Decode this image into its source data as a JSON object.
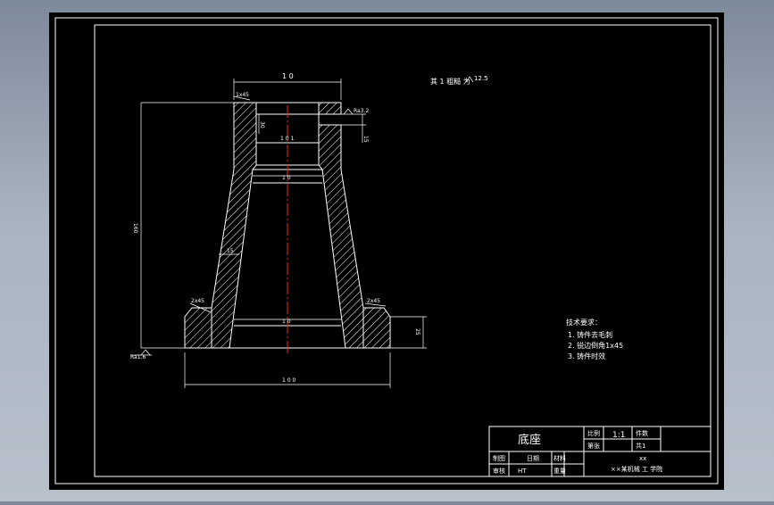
{
  "colors": {
    "background": "#000000",
    "line": "#ffffff",
    "centerline": "#ff2020",
    "hatch": "#ffffff"
  },
  "annotations": {
    "top_width": "1 0",
    "surface_note": "其 1 粗糙 为",
    "surface_note_value": "12.5",
    "chamfer_top_left": "1x45",
    "roughness_right": "Ra3.2",
    "dim_side_small": "15",
    "dim_left_inner": "30",
    "dim_inner_top": "1 0 1",
    "dim_inner_mid": "1 0",
    "dim_inner_bottom": "1 0",
    "dim_overall_height": "160",
    "dim_wall": "15",
    "chamfer_bottom_left": "2x45",
    "chamfer_bottom_right": "2x45",
    "dim_base_height": "25",
    "roughness_bottom": "Ra1.6",
    "dim_base_width": "1 0 0"
  },
  "notes": {
    "title": "技术要求：",
    "items": [
      "1. 铸件去毛刺",
      "2. 锐边倒角1x45",
      "3. 铸件时效"
    ]
  },
  "title_block": {
    "part_name": "底座",
    "scale_label": "比例",
    "scale_value": "1:1",
    "qty_label": "件数",
    "qty_value": "1",
    "sheet_label": "第张",
    "sheet_value": "共1",
    "drawn_label": "制图",
    "drawn_date": "日期",
    "material_label": "材料",
    "check_label": "审核",
    "check_value": "HT",
    "weight_label": "重量",
    "company_line1": "xx",
    "company_line2": "××某机械 工 学院"
  }
}
